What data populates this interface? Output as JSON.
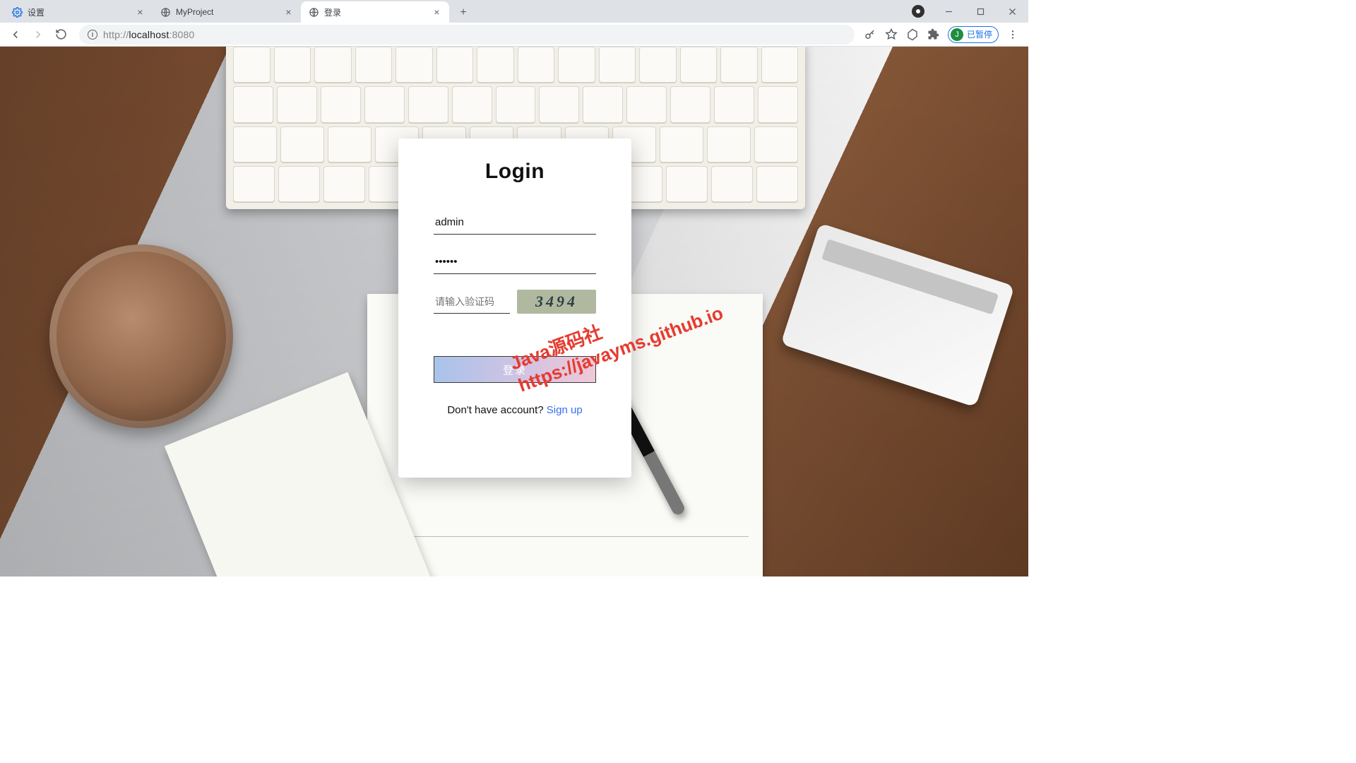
{
  "browser": {
    "tabs": [
      {
        "title": "设置",
        "favicon": "gear"
      },
      {
        "title": "MyProject",
        "favicon": "globe"
      },
      {
        "title": "登录",
        "favicon": "globe"
      }
    ],
    "active_tab_index": 2,
    "url_prefix": "http://",
    "url_host": "localhost",
    "url_port": ":8080",
    "pill_initial": "J",
    "pill_label": "已暂停"
  },
  "login": {
    "title": "Login",
    "username_value": "admin",
    "password_value": "••••••",
    "captcha_placeholder": "请输入验证码",
    "captcha_text": "3494",
    "submit_label": "登录",
    "no_account_text": "Don't have account? ",
    "signup_label": "Sign up"
  },
  "watermark": {
    "line1": "Java源码社",
    "line2": "https://javayms.github.io"
  }
}
